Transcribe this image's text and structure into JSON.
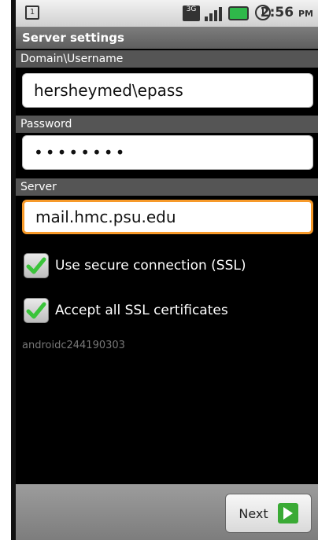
{
  "statusbar": {
    "sim_label": "1",
    "network_label": "3G",
    "time": "2:56",
    "ampm": "PM"
  },
  "header": {
    "title": "Server settings"
  },
  "form": {
    "domain_label": "Domain\\Username",
    "domain_value": "hersheymed\\epass",
    "password_label": "Password",
    "password_value": "••••••••",
    "server_label": "Server",
    "server_value": "mail.hmc.psu.edu",
    "ssl_label": "Use secure connection (SSL)",
    "accept_certs_label": "Accept all SSL certificates",
    "device_id": "androidc244190303"
  },
  "footer": {
    "next_label": "Next"
  }
}
